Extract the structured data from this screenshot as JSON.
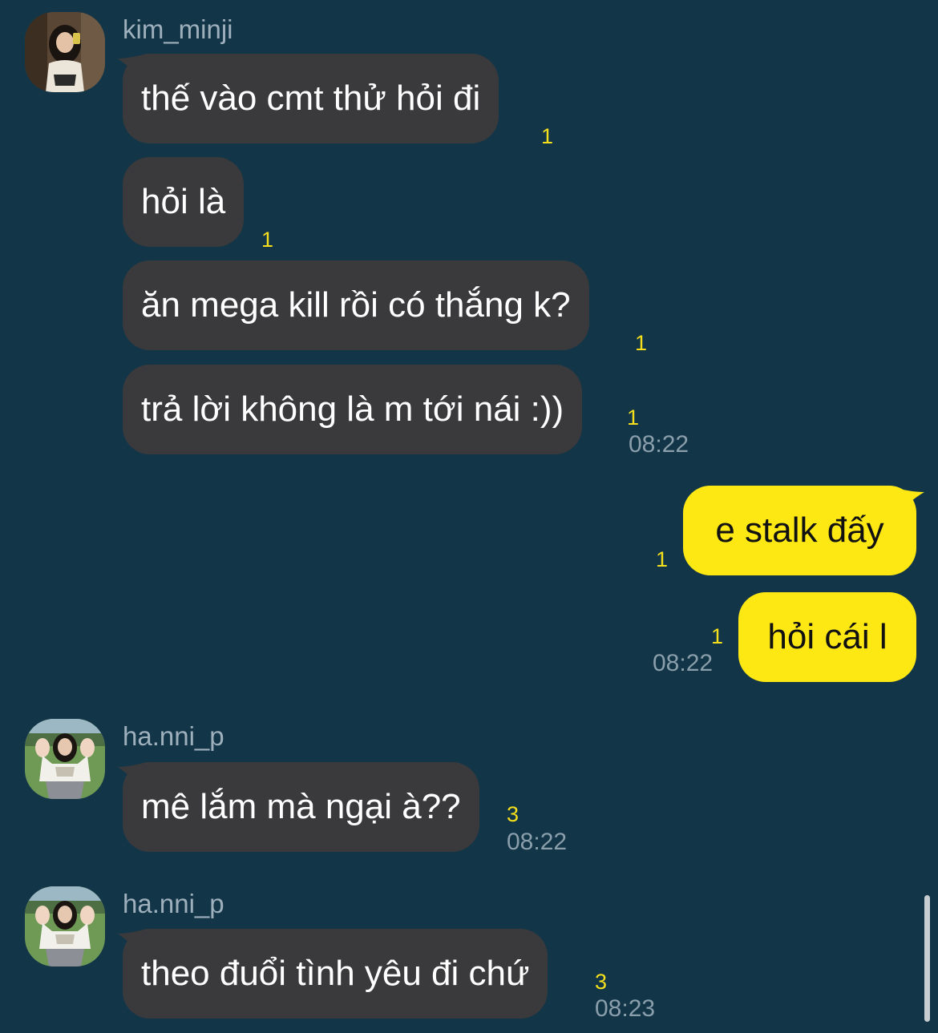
{
  "messages": [
    {
      "sender": "kim_minji",
      "text": "thế vào cmt thử hỏi đi",
      "unread": "1"
    },
    {
      "text": "hỏi là",
      "unread": "1"
    },
    {
      "text": "ăn mega kill rồi có thắng k?",
      "unread": "1"
    },
    {
      "text": "trả lời không là m tới nái :))",
      "unread": "1",
      "time": "08:22"
    },
    {
      "text": "e stalk đấy",
      "unread": "1",
      "outgoing": true
    },
    {
      "text": "hỏi cái l",
      "unread": "1",
      "time": "08:22",
      "outgoing": true
    },
    {
      "sender": "ha.nni_p",
      "text": "mê lắm mà ngại à??",
      "unread": "3",
      "time": "08:22"
    },
    {
      "sender": "ha.nni_p",
      "text": "theo đuổi tình yêu đi chứ",
      "unread": "3",
      "time": "08:23"
    }
  ],
  "colors": {
    "background": "#123548",
    "incoming_bubble": "#3a3a3c",
    "outgoing_bubble": "#fde814",
    "unread_count": "#f5df1c",
    "timestamp": "#8a9eab",
    "sender_name": "#9fb0bd"
  },
  "icons": {
    "avatar_kim_minji": "profile-photo",
    "avatar_ha_nni_p": "profile-photo"
  }
}
